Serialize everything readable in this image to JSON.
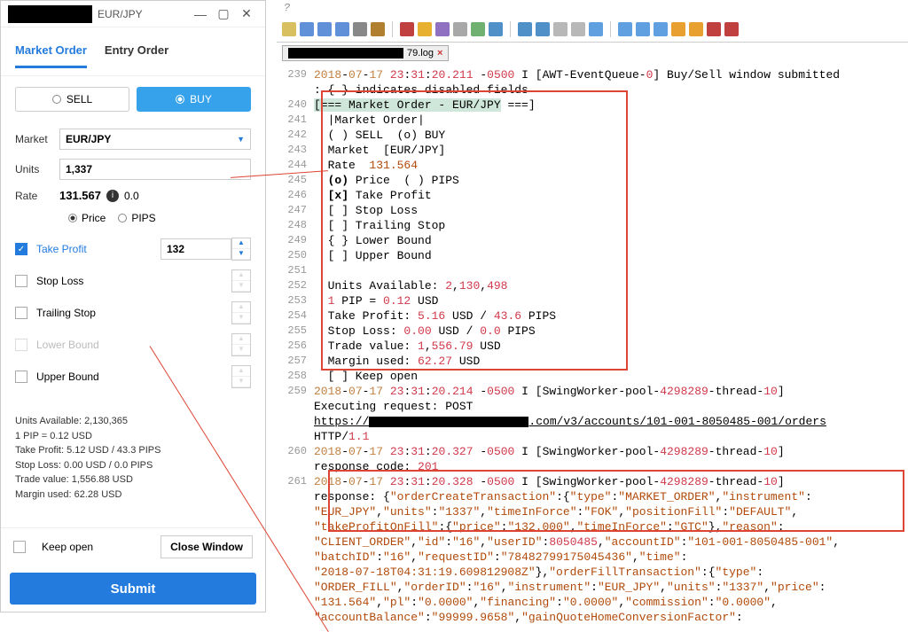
{
  "window": {
    "title": "EUR/JPY",
    "minimize": "—",
    "maximize": "▢",
    "close": "✕"
  },
  "tabs": {
    "market": "Market Order",
    "entry": "Entry Order"
  },
  "form": {
    "sell": "SELL",
    "buy": "BUY",
    "market_label": "Market",
    "market_value": "EUR/JPY",
    "units_label": "Units",
    "units_value": "1,337",
    "rate_label": "Rate",
    "rate_value": "131.567",
    "rate_delta": "0.0",
    "price": "Price",
    "pips": "PIPS",
    "take_profit": "Take Profit",
    "take_profit_value": "132",
    "stop_loss": "Stop Loss",
    "trailing_stop": "Trailing Stop",
    "lower_bound": "Lower Bound",
    "upper_bound": "Upper Bound"
  },
  "summary": {
    "l1": "Units Available: 2,130,365",
    "l2": "1 PIP = 0.12 USD",
    "l3": "Take Profit: 5.12 USD / 43.3 PIPS",
    "l4": "Stop Loss: 0.00 USD / 0.0 PIPS",
    "l5": "Trade value: 1,556.88 USD",
    "l6": "Margin used: 62.28 USD"
  },
  "bottom": {
    "keep_open": "Keep open",
    "close_window": "Close Window",
    "submit": "Submit"
  },
  "editor": {
    "filetab_suffix": "79.log",
    "question_mark": "?",
    "lines": {
      "239a": "2018-07-17 23:31:20.211 -0500 I [AWT-EventQueue-0] Buy/Sell window submitted",
      "239b": ": { } indicates disabled fields",
      "240": "[=== Market Order - EUR/JPY ===]",
      "241": "  |Market Order|",
      "242": "  ( ) SELL  (o) BUY",
      "243": "  Market  [EUR/JPY]",
      "244": "  Rate  131.564",
      "245": "  (o) Price  ( ) PIPS",
      "246": "  [x] Take Profit",
      "247": "  [ ] Stop Loss",
      "248": "  [ ] Trailing Stop",
      "249": "  { } Lower Bound",
      "250": "  [ ] Upper Bound",
      "251": "",
      "252": "  Units Available: 2,130,498",
      "253": "  1 PIP = 0.12 USD",
      "254": "  Take Profit: 5.16 USD / 43.6 PIPS",
      "255": "  Stop Loss: 0.00 USD / 0.0 PIPS",
      "256": "  Trade value: 1,556.79 USD",
      "257": "  Margin used: 62.27 USD",
      "258": "  [ ] Keep open",
      "259a": "2018-07-17 23:31:20.214 -0500 I [SwingWorker-pool-4298289-thread-10]",
      "259b": "Executing request: POST",
      "259c": "https://",
      "259c2": ".com/v3/accounts/101-001-8050485-001/orders",
      "259d": "HTTP/1.1",
      "260a": "2018-07-17 23:31:20.327 -0500 I [SwingWorker-pool-4298289-thread-10]",
      "260b": "response code: 201",
      "261a": "2018-07-17 23:31:20.328 -0500 I [SwingWorker-pool-4298289-thread-10]",
      "261b": "response: {\"orderCreateTransaction\":{\"type\":\"MARKET_ORDER\",\"instrument\":",
      "261c": "\"EUR_JPY\",\"units\":\"1337\",\"timeInForce\":\"FOK\",\"positionFill\":\"DEFAULT\",",
      "261d": "\"takeProfitOnFill\":{\"price\":\"132.000\",\"timeInForce\":\"GTC\"},\"reason\":",
      "261e": "\"CLIENT_ORDER\",\"id\":\"16\",\"userID\":8050485,\"accountID\":\"101-001-8050485-001\",",
      "261f": "\"batchID\":\"16\",\"requestID\":\"78482799175045436\",\"time\":",
      "261g": "\"2018-07-18T04:31:19.609812908Z\"},\"orderFillTransaction\":{\"type\":",
      "261h": "\"ORDER_FILL\",\"orderID\":\"16\",\"instrument\":\"EUR_JPY\",\"units\":\"1337\",\"price\":",
      "261i": "\"131.564\",\"pl\":\"0.0000\",\"financing\":\"0.0000\",\"commission\":\"0.0000\",",
      "261j": "\"accountBalance\":\"99999.9658\",\"gainQuoteHomeConversionFactor\":"
    }
  }
}
